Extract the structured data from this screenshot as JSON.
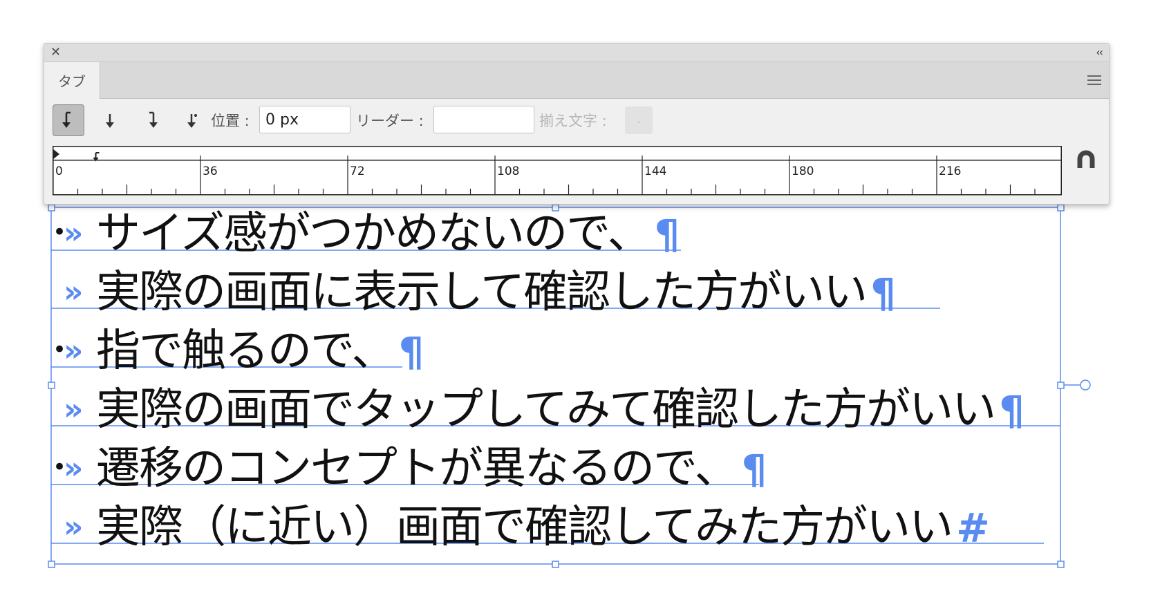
{
  "panel": {
    "tab_label": "タブ",
    "close_symbol": "✕",
    "collapse_symbol": "‹‹",
    "toolbar": {
      "tab_buttons": [
        {
          "name": "left-justified-tab",
          "active": true
        },
        {
          "name": "center-justified-tab",
          "active": false
        },
        {
          "name": "right-justified-tab",
          "active": false
        },
        {
          "name": "decimal-justified-tab",
          "active": false
        }
      ],
      "position_label": "位置 :",
      "position_value": "0 px",
      "leader_label": "リーダー :",
      "leader_value": "",
      "align_on_label": "揃え文字 :",
      "align_on_value": "."
    },
    "ruler": {
      "labels": [
        "0",
        "36",
        "72",
        "108",
        "144",
        "180",
        "216"
      ],
      "tab_stop_value": 4
    }
  },
  "document": {
    "lines": [
      {
        "bullet": "•",
        "tab": "»",
        "text": "サイズ感がつかめないので、",
        "end": "¶"
      },
      {
        "bullet": "",
        "tab": "»",
        "text": "実際の画面に表示して確認した方がいい",
        "end": "¶"
      },
      {
        "bullet": "•",
        "tab": "»",
        "text": "指で触るので、",
        "end": "¶"
      },
      {
        "bullet": "",
        "tab": "»",
        "text": "実際の画面でタップしてみて確認した方がいい",
        "end": "¶"
      },
      {
        "bullet": "•",
        "tab": "»",
        "text": "遷移のコンセプトが異なるので、",
        "end": "¶"
      },
      {
        "bullet": "",
        "tab": "»",
        "text": "実際（に近い）画面で確認してみた方がいい",
        "end": "#"
      }
    ]
  },
  "colors": {
    "selection_blue": "#5a8bf0",
    "panel_bg": "#f0f0f0",
    "text": "#111111"
  }
}
